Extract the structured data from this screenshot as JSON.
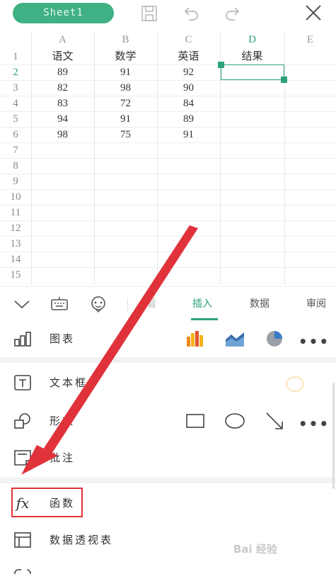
{
  "topbar": {
    "sheet_name": "Sheet1"
  },
  "grid": {
    "columns": [
      "A",
      "B",
      "C",
      "D",
      "E"
    ],
    "rows": [
      "1",
      "2",
      "3",
      "4",
      "5",
      "6",
      "7",
      "8",
      "9",
      "10",
      "11",
      "12",
      "13",
      "14",
      "15"
    ],
    "data": [
      [
        "语文",
        "数学",
        "英语",
        "结果"
      ],
      [
        "89",
        "91",
        "92"
      ],
      [
        "82",
        "98",
        "90"
      ],
      [
        "83",
        "72",
        "84"
      ],
      [
        "94",
        "91",
        "89"
      ],
      [
        "98",
        "75",
        "91"
      ]
    ],
    "selected_cell": "D2"
  },
  "tabs": {
    "items": [
      "看",
      "插入",
      "数据",
      "审阅"
    ],
    "active": "插入"
  },
  "panel": {
    "chart_label": "图表",
    "textbox_label": "文本框",
    "shape_label": "形状",
    "comment_label": "批注",
    "function_label": "函数",
    "function_icon_text": "fx",
    "pivot_label": "数据透视表",
    "more_label": "•••"
  },
  "colors": {
    "accent": "#2ea27a",
    "highlight": "#e0323a",
    "sheet_pill": "#3fb184"
  },
  "watermark": "Bai 经验"
}
